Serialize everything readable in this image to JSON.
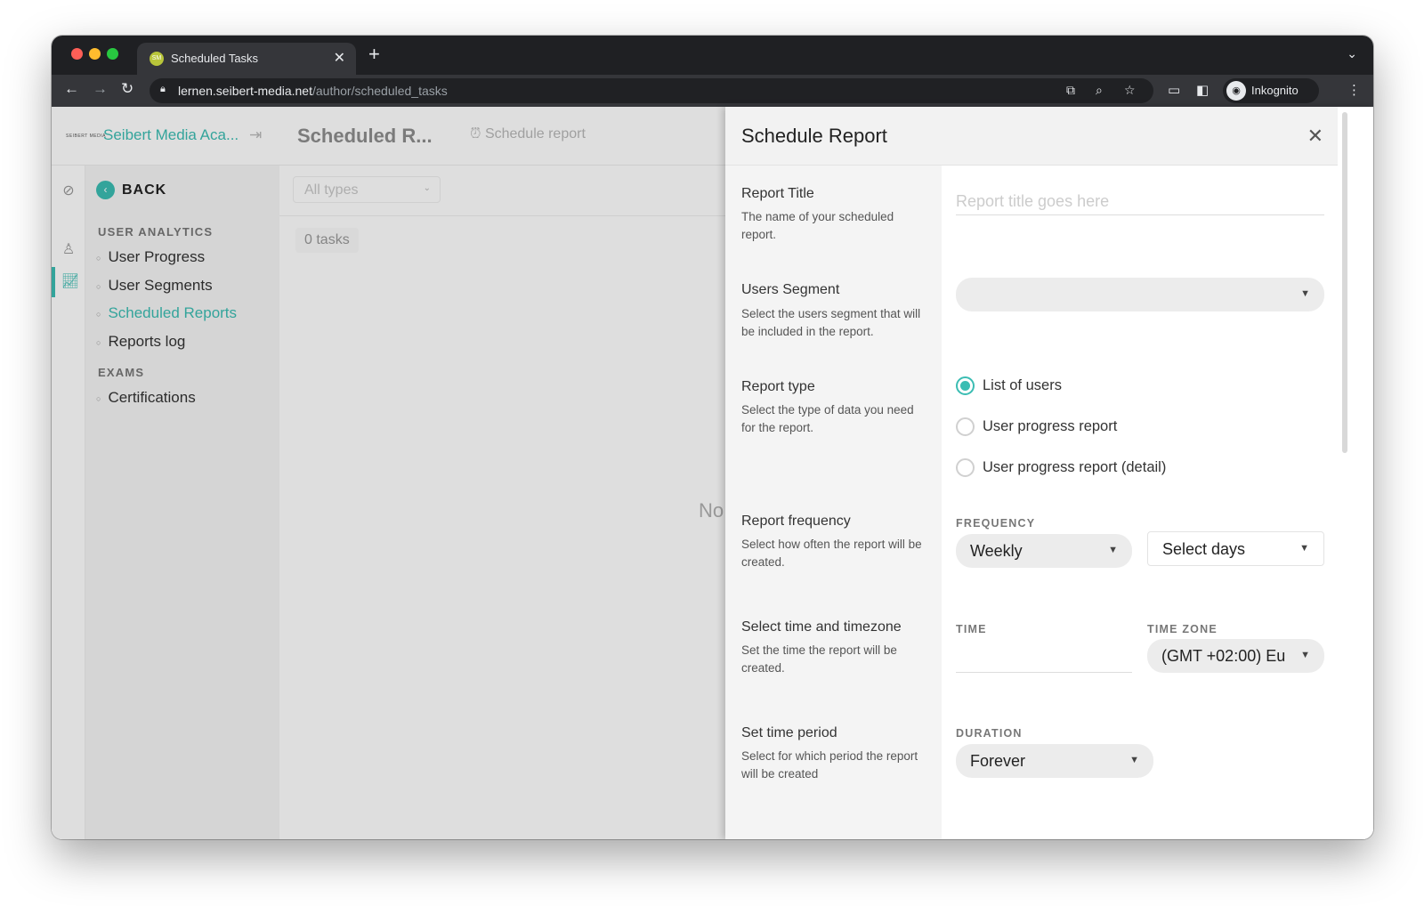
{
  "browser": {
    "tab_title": "Scheduled Tasks",
    "tab_favicon_text": "SM",
    "url_host": "lernen.seibert-media.net",
    "url_path": "/author/scheduled_tasks",
    "profile_label": "Inkognito"
  },
  "app": {
    "logo_text": "SEIBERT MEDIA",
    "brand": "Seibert Media Aca...",
    "page_title": "Scheduled R...",
    "schedule_button": "Schedule report"
  },
  "sidebar": {
    "back_label": "BACK",
    "sections": [
      {
        "label": "USER ANALYTICS",
        "items": [
          "User Progress",
          "User Segments",
          "Scheduled Reports",
          "Reports log"
        ]
      },
      {
        "label": "EXAMS",
        "items": [
          "Certifications"
        ]
      }
    ],
    "active_item": "Scheduled Reports"
  },
  "content": {
    "filter_value": "All types",
    "tasks_count": "0 tasks",
    "empty_text": "No"
  },
  "panel": {
    "title": "Schedule Report",
    "report_title": {
      "title": "Report Title",
      "desc": "The name of your scheduled report.",
      "placeholder": "Report title goes here"
    },
    "users_segment": {
      "title": "Users Segment",
      "desc": "Select the users segment that will be included in the report.",
      "value": ""
    },
    "report_type": {
      "title": "Report type",
      "desc": "Select the type of data you need for the report.",
      "options": [
        "List of users",
        "User progress report",
        "User progress report (detail)"
      ],
      "selected": "List of users"
    },
    "frequency": {
      "title": "Report frequency",
      "desc": "Select how often the report will be created.",
      "caption": "FREQUENCY",
      "value": "Weekly",
      "days_value": "Select days"
    },
    "time": {
      "title": "Select time and timezone",
      "desc": "Set the time the report will be created.",
      "time_caption": "TIME",
      "time_value": "",
      "zone_caption": "TIME ZONE",
      "zone_value": "(GMT +02:00) Eu"
    },
    "period": {
      "title": "Set time period",
      "desc": "Select for which period the report will be created",
      "caption": "DURATION",
      "value": "Forever"
    }
  },
  "colors": {
    "accent": "#3bbdb3",
    "chrome_dark": "#1f2023",
    "chrome_toolbar": "#35363a"
  }
}
